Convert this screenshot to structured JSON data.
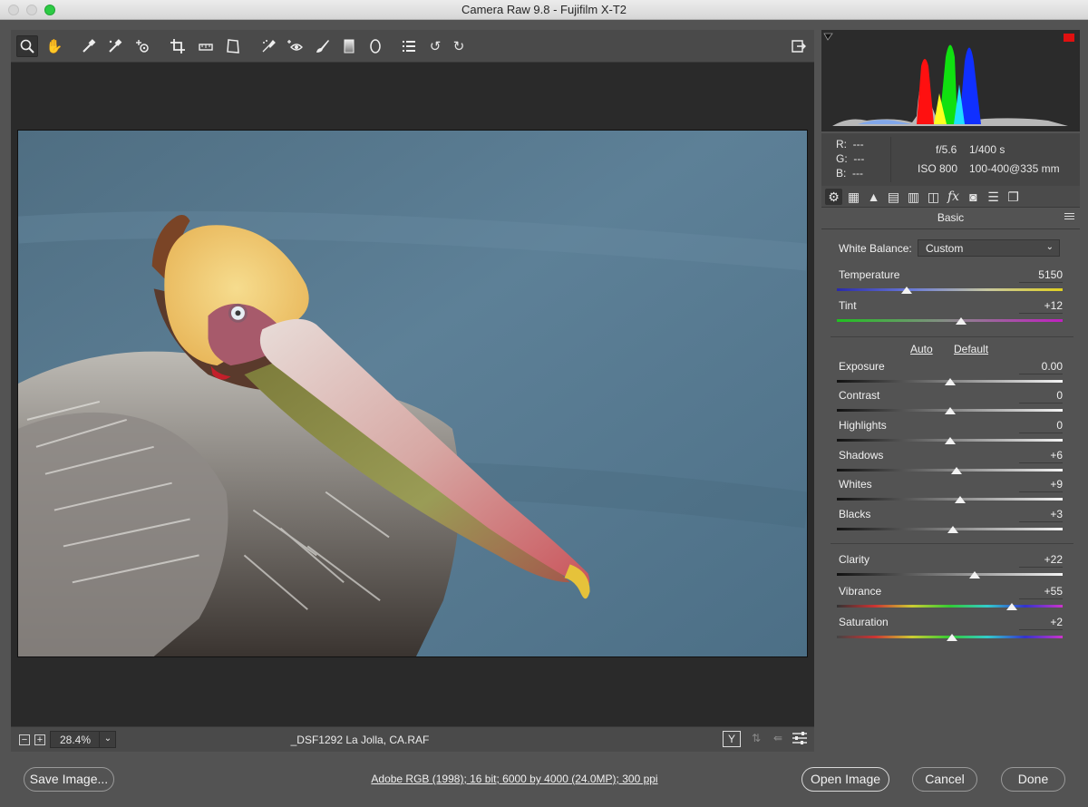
{
  "window": {
    "title": "Camera Raw 9.8  -  Fujifilm X-T2"
  },
  "toolbar": {
    "tools": [
      "zoom-tool-icon",
      "hand-tool-icon",
      "white-balance-tool-icon",
      "color-sampler-tool-icon",
      "targeted-adjustment-tool-icon",
      "crop-tool-icon",
      "straighten-tool-icon",
      "transform-tool-icon",
      "spot-removal-tool-icon",
      "red-eye-removal-icon",
      "adjustment-brush-icon",
      "graduated-filter-icon",
      "radial-filter-icon",
      "preferences-icon",
      "rotate-ccw-icon",
      "rotate-cw-icon"
    ],
    "fullscreen_icon": "toggle-fullscreen-icon"
  },
  "status": {
    "zoom": "28.4%",
    "filename": "_DSF1292 La Jolla, CA.RAF"
  },
  "histogram": {
    "shadow_clip_icon": "shadow-clipping-warning-icon",
    "highlight_clip_icon": "highlight-clipping-warning-icon",
    "highlight_clip_color": "#e01010"
  },
  "info": {
    "r_label": "R:",
    "r_value": "---",
    "g_label": "G:",
    "g_value": "---",
    "b_label": "B:",
    "b_value": "---",
    "aperture": "f/5.6",
    "shutter": "1/400 s",
    "iso": "ISO 800",
    "lens": "100-400@335 mm"
  },
  "panel": {
    "title": "Basic",
    "white_balance_label": "White Balance:",
    "white_balance_value": "Custom",
    "auto_label": "Auto",
    "default_label": "Default",
    "sliders": [
      {
        "label": "Temperature",
        "value": "5150",
        "position": 0.31
      },
      {
        "label": "Tint",
        "value": "+12",
        "position": 0.55
      },
      {
        "label": "Exposure",
        "value": "0.00",
        "position": 0.5
      },
      {
        "label": "Contrast",
        "value": "0",
        "position": 0.5
      },
      {
        "label": "Highlights",
        "value": "0",
        "position": 0.5
      },
      {
        "label": "Shadows",
        "value": "+6",
        "position": 0.53
      },
      {
        "label": "Whites",
        "value": "+9",
        "position": 0.545
      },
      {
        "label": "Blacks",
        "value": "+3",
        "position": 0.515
      },
      {
        "label": "Clarity",
        "value": "+22",
        "position": 0.61
      },
      {
        "label": "Vibrance",
        "value": "+55",
        "position": 0.775
      },
      {
        "label": "Saturation",
        "value": "+2",
        "position": 0.51
      }
    ]
  },
  "bottom": {
    "save_label": "Save Image...",
    "workflow": "Adobe RGB (1998); 16 bit; 6000 by 4000 (24.0MP); 300 ppi",
    "open_label": "Open Image",
    "cancel_label": "Cancel",
    "done_label": "Done"
  }
}
